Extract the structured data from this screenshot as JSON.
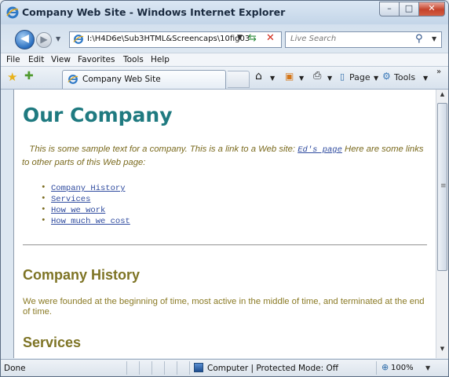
{
  "window": {
    "title": "Company Web Site - Windows Internet Explorer"
  },
  "controls": {
    "min": "–",
    "max": "□",
    "close": "✕"
  },
  "nav": {
    "back_glyph": "◀",
    "forward_glyph": "▶",
    "address": "I:\\H4D6e\\Sub3HTML&Screencaps\\10fig03",
    "search_placeholder": "Live Search"
  },
  "menu": [
    "File",
    "Edit",
    "View",
    "Favorites",
    "Tools",
    "Help"
  ],
  "tab": {
    "label": "Company Web Site"
  },
  "commands": {
    "page": "Page",
    "tools": "Tools"
  },
  "content": {
    "heading": "Our Company",
    "intro_text": "This is some sample text for a company. This is a link to a Web site: ",
    "intro_link": "Ed's page",
    "intro_after": " Here are some links to other parts of this Web page:",
    "links": [
      "Company History",
      "Services",
      "How we work",
      "How much we cost"
    ],
    "history_heading": "Company History",
    "history_text": "We were founded at the beginning of time, most active in the middle of time, and terminated at the end of time.",
    "services_heading": "Services"
  },
  "status": {
    "text": "Done",
    "zone": "Computer | Protected Mode: Off",
    "zoom": "100%"
  },
  "colors": {
    "heading": "#1f7a80",
    "body_text": "#8a7a24",
    "link": "#2f4b9f"
  }
}
